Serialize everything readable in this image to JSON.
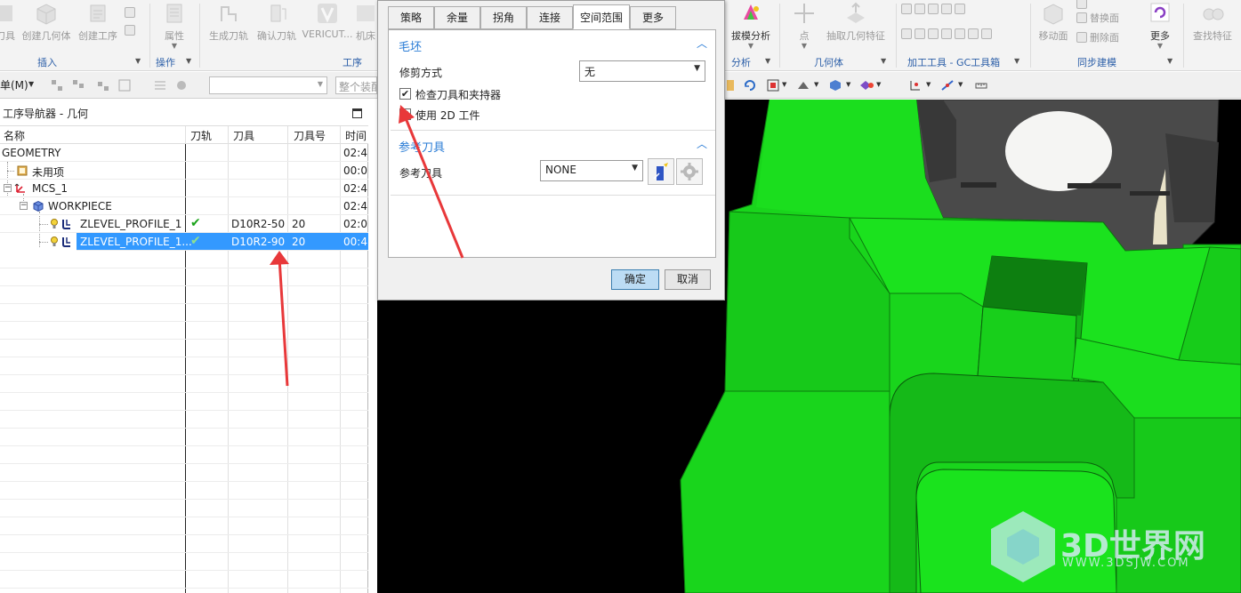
{
  "ribbon": {
    "items": [
      {
        "label": "刀具"
      },
      {
        "label": "创建几何体"
      },
      {
        "label": "创建工序"
      },
      {
        "label": "属性"
      },
      {
        "label": "生成刀轨"
      },
      {
        "label": "确认刀轨"
      },
      {
        "label": "VERICUT..."
      },
      {
        "label": "机床"
      },
      {
        "label": "拔模分析"
      },
      {
        "label": "点"
      },
      {
        "label": "抽取几何特征"
      },
      {
        "label": "移动面"
      },
      {
        "label": "更多"
      },
      {
        "label": "查找特征"
      }
    ],
    "small_items": [
      {
        "label": "替换面"
      },
      {
        "label": "删除面"
      }
    ],
    "groups": [
      {
        "label": "插入"
      },
      {
        "label": "操作"
      },
      {
        "label": "工序"
      },
      {
        "label": "分析"
      },
      {
        "label": "几何体"
      },
      {
        "label": "加工工具 - GC工具箱"
      },
      {
        "label": "同步建模"
      }
    ]
  },
  "toolbar2": {
    "menu_label": "单(M)",
    "filter_placeholder": "整个装配"
  },
  "navigator": {
    "title": "工序导航器 - 几何",
    "columns": [
      "名称",
      "刀轨",
      "刀具",
      "刀具号",
      "时间"
    ],
    "rows": [
      {
        "name": "GEOMETRY",
        "path": "",
        "tool": "",
        "tool_no": "",
        "time": "02:4"
      },
      {
        "name": "未用项",
        "path": "",
        "tool": "",
        "tool_no": "",
        "time": "00:0"
      },
      {
        "name": "MCS_1",
        "path": "",
        "tool": "",
        "tool_no": "",
        "time": "02:4"
      },
      {
        "name": "WORKPIECE",
        "path": "",
        "tool": "",
        "tool_no": "",
        "time": "02:4"
      },
      {
        "name": "ZLEVEL_PROFILE_1",
        "path": "✔",
        "tool": "D10R2-50",
        "tool_no": "20",
        "time": "02:0"
      },
      {
        "name": "ZLEVEL_PROFILE_1...",
        "path": "✔",
        "tool": "D10R2-90",
        "tool_no": "20",
        "time": "00:4"
      }
    ]
  },
  "dialog": {
    "tabs": [
      {
        "label": "策略"
      },
      {
        "label": "余量"
      },
      {
        "label": "拐角"
      },
      {
        "label": "连接"
      },
      {
        "label": "空间范围"
      },
      {
        "label": "更多"
      }
    ],
    "section_blank": {
      "title": "毛坯",
      "trim_label": "修剪方式",
      "trim_value": "无",
      "check_holder_label": "检查刀具和夹持器",
      "check_holder_checked": true,
      "use_2d_label": "使用 2D 工件",
      "use_2d_checked": true
    },
    "section_ref_tool": {
      "title": "参考刀具",
      "ref_tool_label": "参考刀具",
      "ref_tool_value": "NONE"
    },
    "ok_label": "确定",
    "cancel_label": "取消"
  },
  "watermark": {
    "brand": "3D世界网",
    "url": "WWW.3DSJW.COM"
  },
  "colors": {
    "accent": "#2b7dd6",
    "selection": "#3399ff",
    "model_green": "#19d51c",
    "annotation_red": "#e8383a"
  }
}
